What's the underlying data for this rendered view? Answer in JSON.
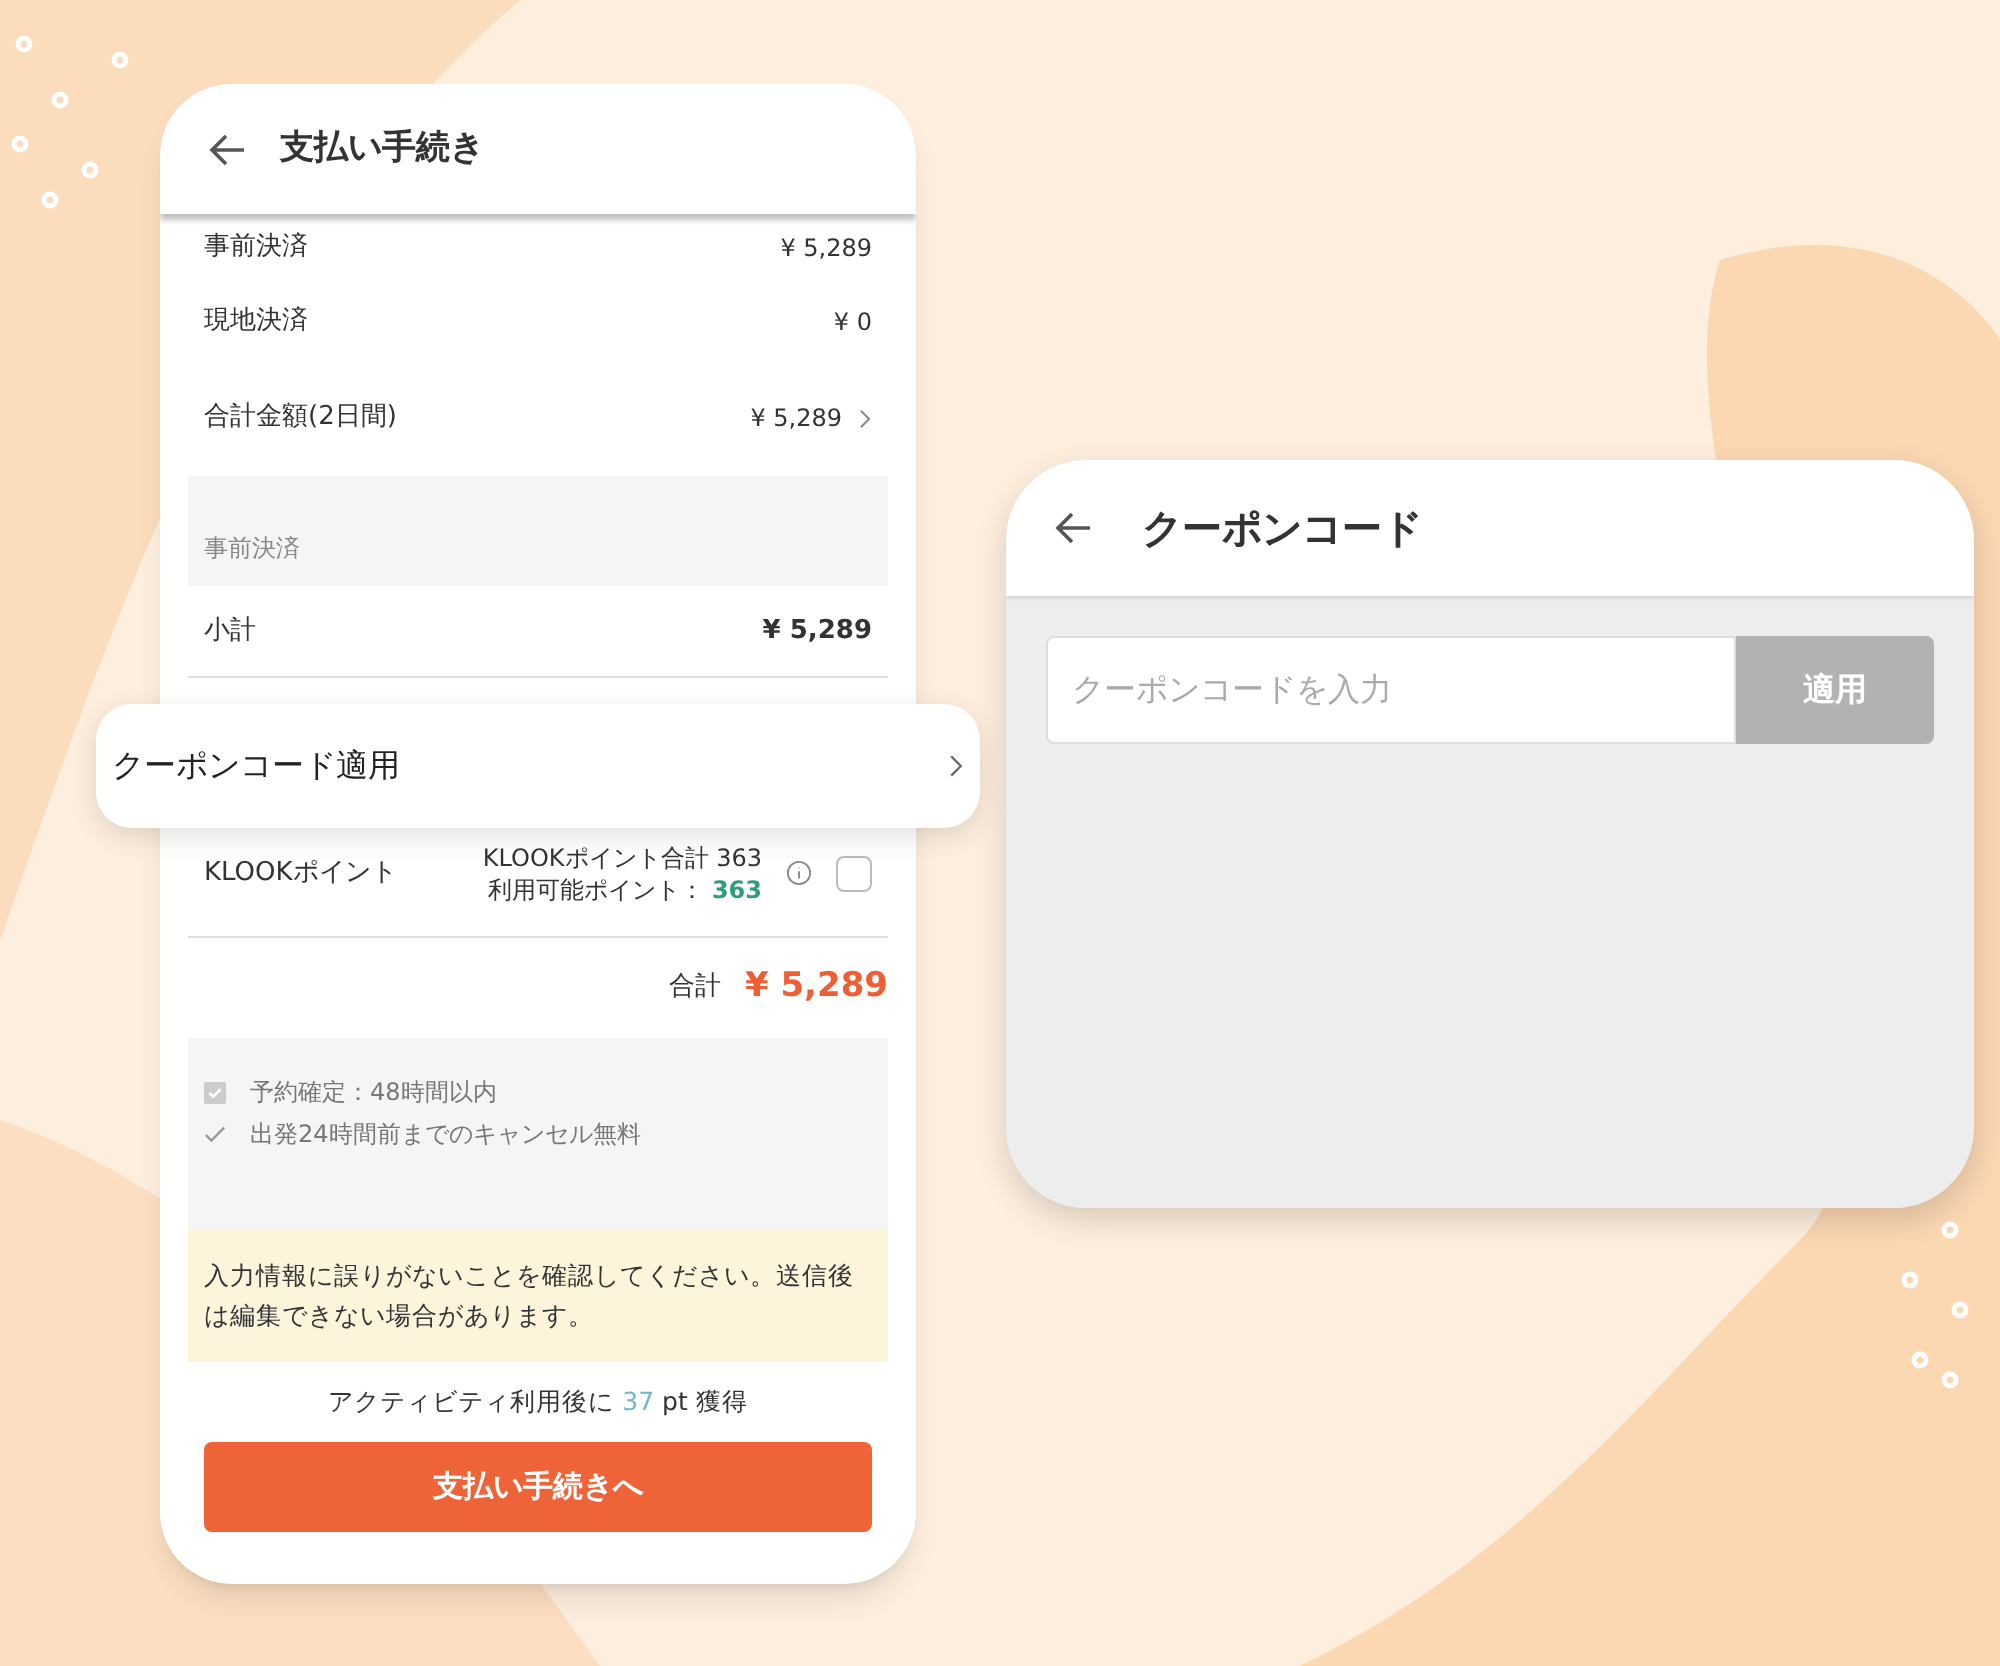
{
  "checkout": {
    "title": "支払い手続き",
    "rows": [
      {
        "label": "事前決済",
        "value": "¥ 5,289",
        "kind": "plain"
      },
      {
        "label": "現地決済",
        "value": "¥ 0",
        "kind": "plain"
      },
      {
        "label": "合計金額(2日間)",
        "value": "¥ 5,289",
        "kind": "link"
      }
    ],
    "section_label": "事前決済",
    "subtotal": {
      "label": "小計",
      "value": "¥ 5,289"
    },
    "points": {
      "label": "KLOOKポイント",
      "total": "KLOOKポイント合計 363",
      "available_label": "利用可能ポイント：",
      "available": "363",
      "checked": false
    },
    "total": {
      "label": "合計",
      "value": "¥ 5,289"
    },
    "features": [
      {
        "kind": "checkbox",
        "text": "予約確定：48時間以内"
      },
      {
        "kind": "check",
        "text": "出発24時間前までのキャンセル無料"
      }
    ],
    "notice": "入力情報に誤りがないことを確認してください。送信後は編集できない場合があります。",
    "earn": {
      "before": "アクティビティ利用後に",
      "points": "37",
      "after": "pt 獲得"
    },
    "submit": "支払い手続きへ"
  },
  "coupon_row": {
    "label": "クーポンコード適用"
  },
  "coupon_screen": {
    "title": "クーポンコード",
    "placeholder": "クーポンコードを入力",
    "apply": "適用"
  }
}
